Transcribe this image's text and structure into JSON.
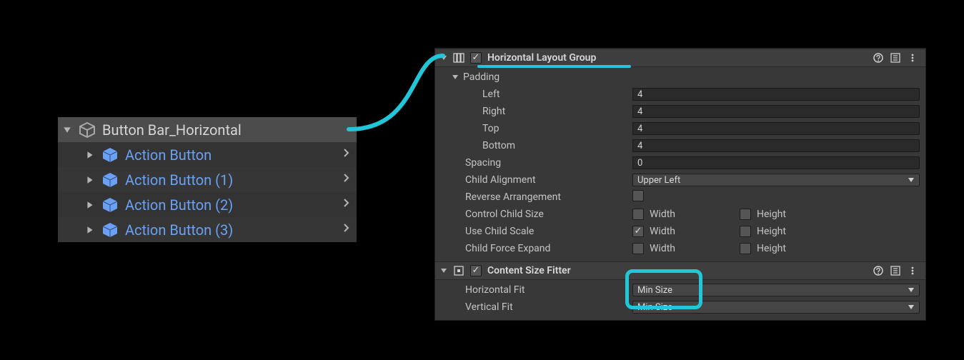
{
  "accent_color": "#21c7d8",
  "hierarchy": {
    "parent": "Button Bar_Horizontal",
    "children": [
      "Action Button",
      "Action Button (1)",
      "Action Button (2)",
      "Action Button (3)"
    ]
  },
  "hlg": {
    "title": "Horizontal Layout Group",
    "enabled": true,
    "padding_label": "Padding",
    "left_label": "Left",
    "right_label": "Right",
    "top_label": "Top",
    "bottom_label": "Bottom",
    "left": "4",
    "right": "4",
    "top": "4",
    "bottom": "4",
    "spacing_label": "Spacing",
    "spacing": "0",
    "child_alignment_label": "Child Alignment",
    "child_alignment": "Upper Left",
    "reverse_label": "Reverse Arrangement",
    "reverse": false,
    "control_label": "Control Child Size",
    "control_w": false,
    "control_h": false,
    "scale_label": "Use Child Scale",
    "scale_w": true,
    "scale_h": false,
    "force_label": "Child Force Expand",
    "force_w": false,
    "force_h": false,
    "width_label": "Width",
    "height_label": "Height"
  },
  "csf": {
    "title": "Content Size Fitter",
    "enabled": true,
    "hfit_label": "Horizontal Fit",
    "hfit": "Min Size",
    "vfit_label": "Vertical Fit",
    "vfit": "Min Size"
  }
}
